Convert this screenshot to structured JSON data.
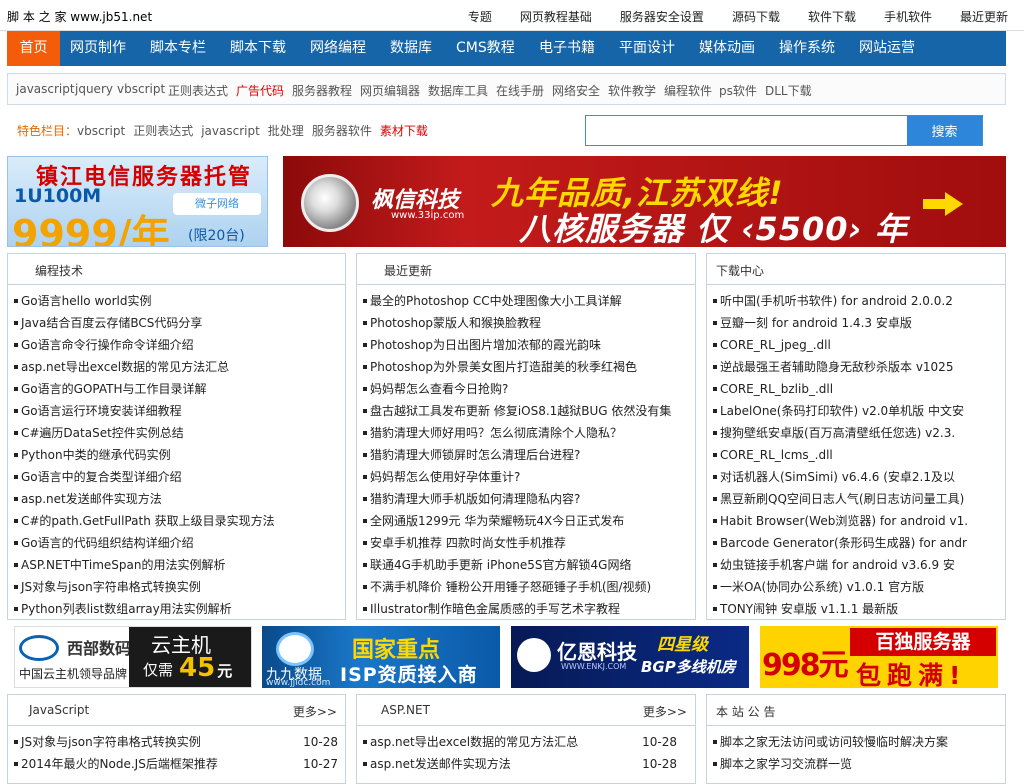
{
  "topbar": {
    "site_name": "脚 本 之 家 www.jb51.net",
    "links": [
      "专题",
      "网页教程基础",
      "服务器安全设置",
      "源码下载",
      "软件下载",
      "手机软件",
      "最近更新"
    ]
  },
  "nav": {
    "items": [
      "首页",
      "网页制作",
      "脚本专栏",
      "脚本下载",
      "网络编程",
      "数据库",
      "CMS教程",
      "电子书籍",
      "平面设计",
      "媒体动画",
      "操作系统",
      "网站运营"
    ]
  },
  "subnav": {
    "items": [
      "javascript",
      "jquery",
      "vbscript",
      "正则表达式",
      "广告代码",
      "服务器教程",
      "网页编辑器",
      "数据库工具",
      "在线手册",
      "网络安全",
      "软件教学",
      "编程软件",
      "ps软件",
      "DLL下载"
    ]
  },
  "featured": {
    "label": "特色栏目：",
    "items": [
      "vbscript",
      "正则表达式",
      "javascript",
      "批处理",
      "服务器软件",
      "素材下载"
    ]
  },
  "search": {
    "placeholder": "",
    "button": "搜索"
  },
  "ads": {
    "top_left": {
      "line1": "镇江电信服务器托管",
      "line2": "1U100M",
      "price": "9999/年",
      "note": "(限20台)",
      "logo": "微子网络"
    },
    "top_right": {
      "brand": "枫信科技",
      "url": "www.33ip.com",
      "headline1": "九年品质,江苏双线!",
      "headline2": "八核服务器 仅 ‹5500› 年"
    },
    "row": {
      "west": {
        "brand": "西部数码",
        "tag": "中国云主机领导品牌",
        "product": "云主机",
        "only": "仅需",
        "price": "45",
        "unit": "元"
      },
      "jjidc": {
        "brand": "九九数据",
        "url": "www.jjidc.com",
        "line1": "国家重点",
        "line2": "ISP资质接入商"
      },
      "enkj": {
        "brand": "亿恩科技",
        "url": "WWW.ENKJ.COM",
        "line1": "四星级",
        "line2": "BGP多线机房"
      },
      "998": {
        "price": "998元",
        "line1": "百独服务器",
        "line2": "包跑满!"
      }
    }
  },
  "panels": {
    "programming": {
      "title": "编程技术",
      "items": [
        "Go语言hello world实例",
        "Java结合百度云存储BCS代码分享",
        "Go语言命令行操作命令详细介绍",
        "asp.net导出excel数据的常见方法汇总",
        "Go语言的GOPATH与工作目录详解",
        "Go语言运行环境安装详细教程",
        "C#遍历DataSet控件实例总结",
        "Python中类的继承代码实例",
        "Go语言中的复合类型详细介绍",
        "asp.net发送邮件实现方法",
        "C#的path.GetFullPath 获取上级目录实现方法",
        "Go语言的代码组织结构详细介绍",
        "ASP.NET中TimeSpan的用法实例解析",
        "JS对象与json字符串格式转换实例",
        "Python列表list数组array用法实例解析"
      ]
    },
    "recent": {
      "title": "最近更新",
      "items": [
        "最全的Photoshop CC中处理图像大小工具详解",
        "Photoshop蒙版人和猴换脸教程",
        "Photoshop为日出图片增加浓郁的霞光韵味",
        "Photoshop为外景美女图片打造甜美的秋季红褐色",
        "妈妈帮怎么查看今日抢购?",
        "盘古越狱工具发布更新 修复iOS8.1越狱BUG 依然没有集",
        "猎豹清理大师好用吗？怎么彻底清除个人隐私？",
        "猎豹清理大师锁屏时怎么清理后台进程?",
        "妈妈帮怎么使用好孕体重计?",
        "猎豹清理大师手机版如何清理隐私内容?",
        "全网通版1299元 华为荣耀畅玩4X今日正式发布",
        "安卓手机推荐 四款时尚女性手机推荐",
        "联通4G手机助手更新 iPhone5S官方解锁4G网络",
        "不满手机降价 锤粉公开用锤子怒砸锤子手机(图/视频)",
        "Illustrator制作暗色金属质感的手写艺术字教程"
      ]
    },
    "downloads": {
      "title": "下载中心",
      "items": [
        "听中国(手机听书软件) for android 2.0.0.2",
        "豆瓣一刻 for android 1.4.3 安卓版",
        "CORE_RL_jpeg_.dll",
        "逆战最强王者辅助隐身无敌秒杀版本 v1025",
        "CORE_RL_bzlib_.dll",
        "LabelOne(条码打印软件) v2.0单机版 中文安",
        "搜狗壁纸安卓版(百万高清壁纸任您选) v2.3.",
        "CORE_RL_lcms_.dll",
        "对话机器人(SimSimi) v6.4.6 (安卓2.1及以",
        "黑豆新刷QQ空间日志人气(刷日志访问量工具)",
        "Habit Browser(Web浏览器) for android v1.",
        "Barcode Generator(条形码生成器) for andr",
        "幼虫链接手机客户端 for android v3.6.9 安",
        "一米OA(协同办公系统) v1.0.1 官方版",
        "TONY闹钟 安卓版 v1.1.1 最新版"
      ]
    },
    "javascript": {
      "title": "JavaScript",
      "more": "更多>>",
      "items": [
        {
          "text": "JS对象与json字符串格式转换实例",
          "date": "10-28"
        },
        {
          "text": "2014年最火的Node.JS后端框架推荐",
          "date": "10-27"
        }
      ]
    },
    "aspnet": {
      "title": "ASP.NET",
      "more": "更多>>",
      "items": [
        {
          "text": "asp.net导出excel数据的常见方法汇总",
          "date": "10-28"
        },
        {
          "text": "asp.net发送邮件实现方法",
          "date": "10-28"
        }
      ]
    },
    "notice": {
      "title": "本 站 公 告",
      "items": [
        "脚本之家无法访问或访问较慢临时解决方案",
        "脚本之家学习交流群一览"
      ]
    }
  },
  "colors": {
    "nav_bg": "#1565a8",
    "nav_active": "#f25c0a",
    "search_btn": "#2d86d9",
    "accent_red": "#d90000",
    "accent_orange": "#e06a00"
  }
}
